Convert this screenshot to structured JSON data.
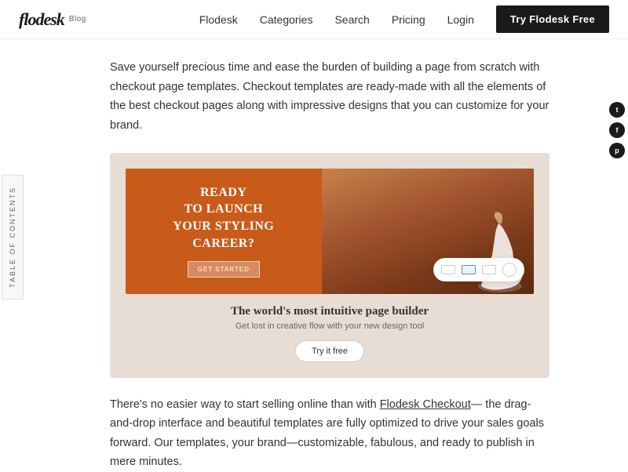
{
  "nav": {
    "logo": "flodesk",
    "logo_blog": "Blog",
    "links": [
      "Flodesk",
      "Categories",
      "Search",
      "Pricing",
      "Login"
    ],
    "cta": "Try Flodesk Free"
  },
  "toc": {
    "label": "TABLE OF CONTENTS"
  },
  "social": {
    "icons": [
      "t",
      "f",
      "p"
    ]
  },
  "intro": {
    "text": "Save yourself precious time and ease the burden of building a page from scratch with checkout page templates. Checkout templates are ready-made with all the elements of the best checkout pages along with impressive designs that you can customize for your brand."
  },
  "promo": {
    "title": "READY\nTO LAUNCH\nYOUR STYLING\nCAREER?",
    "btn": "GET STARTED",
    "tagline": "The world's most intuitive page builder",
    "sub": "Get lost in creative flow with your new design tool",
    "try_btn": "Try it free"
  },
  "body": {
    "text_before_link": "There's no easier way to start selling online than with ",
    "link_text": "Flodesk Checkout",
    "text_after_link": "—\nthe drag-and-drop interface and beautiful templates are fully optimized to\ndrive your sales goals forward. Our templates, your brand—customizable,\nfabulous, and ready to publish in mere minutes."
  }
}
